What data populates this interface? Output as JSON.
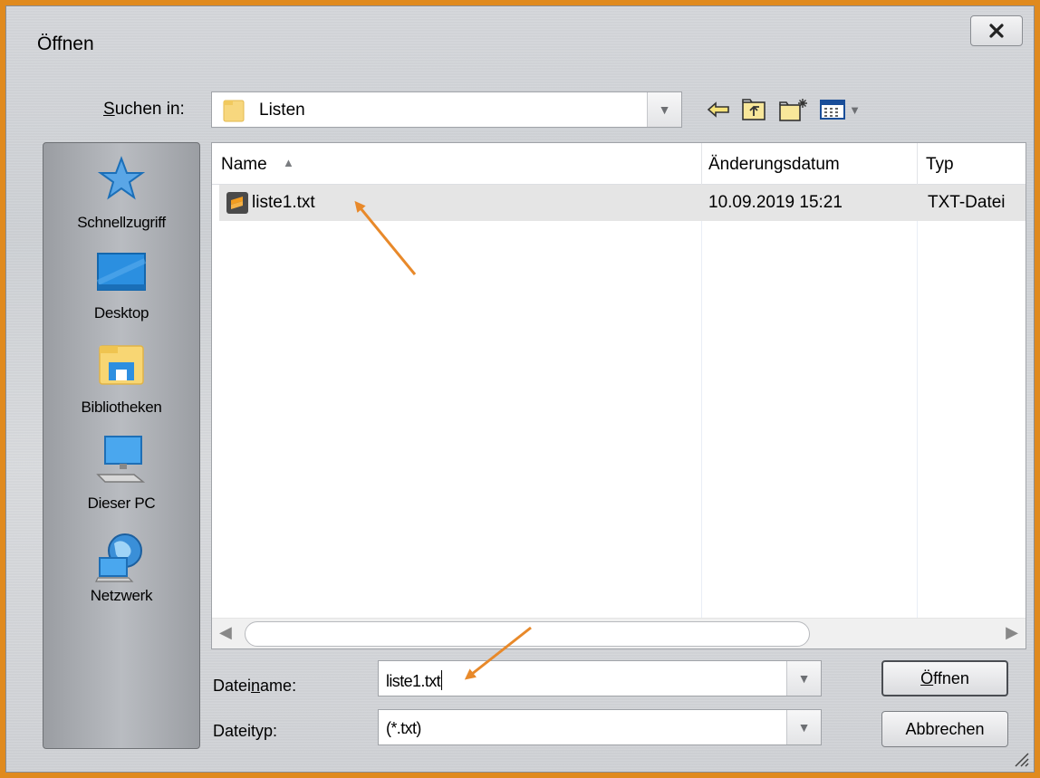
{
  "dialog": {
    "title": "Öffnen",
    "close_label": "×"
  },
  "lookin": {
    "label_prefix": "S",
    "label_rest": "uchen in:",
    "value": "Listen"
  },
  "places": [
    {
      "label": "Schnellzugriff",
      "icon": "star-icon"
    },
    {
      "label": "Desktop",
      "icon": "desktop-icon"
    },
    {
      "label": "Bibliotheken",
      "icon": "libraries-icon"
    },
    {
      "label": "Dieser PC",
      "icon": "computer-icon"
    },
    {
      "label": "Netzwerk",
      "icon": "network-icon"
    }
  ],
  "columns": [
    "Name",
    "Änderungsdatum",
    "Typ"
  ],
  "files": [
    {
      "name": "liste1.txt",
      "modified": "10.09.2019 15:21",
      "type": "TXT-Datei"
    }
  ],
  "filename": {
    "label_pre": "Datei",
    "label_u": "n",
    "label_post": "ame:",
    "value": "liste1.txt"
  },
  "filetype": {
    "label": "Dateityp:",
    "value": "(*.txt)"
  },
  "buttons": {
    "open_pre": "",
    "open_u": "Ö",
    "open_post": "ffnen",
    "cancel": "Abbrechen"
  },
  "colors": {
    "annotation": "#e8892a",
    "frame": "#e08a1e"
  }
}
